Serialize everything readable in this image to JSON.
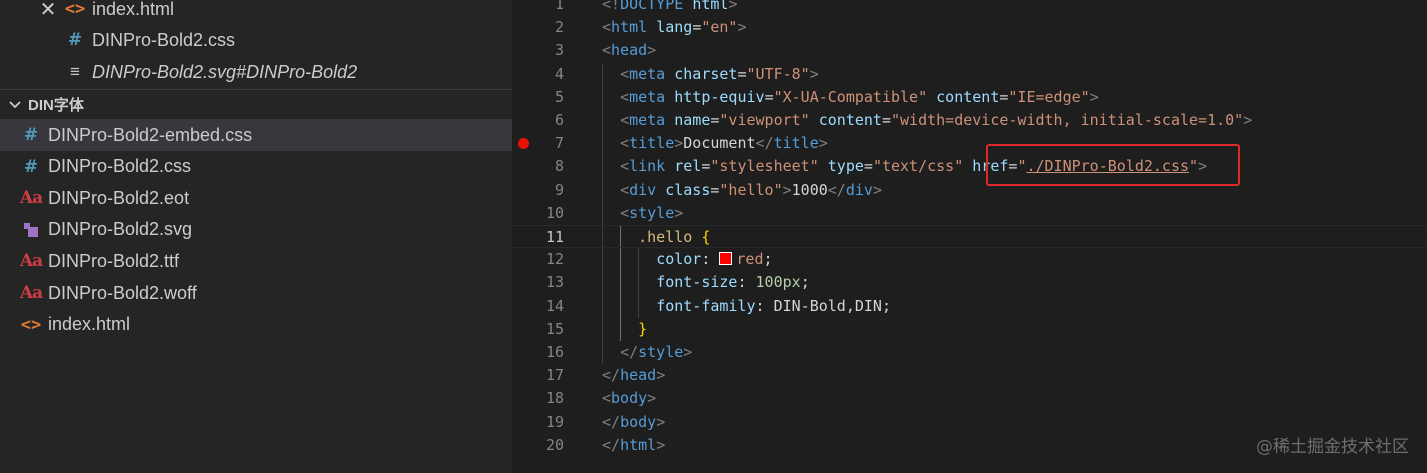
{
  "open_editors": [
    {
      "name": "index.html",
      "icon": "html-file-icon",
      "italic": false,
      "close": true
    },
    {
      "name": "DINPro-Bold2.css",
      "icon": "css-file-icon",
      "italic": false,
      "close": false
    },
    {
      "name": "DINPro-Bold2.svg#DINPro-Bold2",
      "icon": "svg-reference-icon",
      "italic": true,
      "close": false
    }
  ],
  "folder": {
    "name": "DIN字体",
    "expanded": true
  },
  "files": [
    {
      "name": "DINPro-Bold2-embed.css",
      "icon": "css-file-icon",
      "selected": true
    },
    {
      "name": "DINPro-Bold2.css",
      "icon": "css-file-icon",
      "selected": false
    },
    {
      "name": "DINPro-Bold2.eot",
      "icon": "font-file-icon",
      "selected": false
    },
    {
      "name": "DINPro-Bold2.svg",
      "icon": "svg-file-icon",
      "selected": false
    },
    {
      "name": "DINPro-Bold2.ttf",
      "icon": "font-file-icon",
      "selected": false
    },
    {
      "name": "DINPro-Bold2.woff",
      "icon": "font-file-icon",
      "selected": false
    },
    {
      "name": "index.html",
      "icon": "html-file-icon",
      "selected": false
    }
  ],
  "editor": {
    "current_line": 11,
    "breakpoint_line": 7,
    "lines": [
      [
        [
          "t-pun",
          "<!"
        ],
        [
          "t-tag",
          "DOCTYPE"
        ],
        [
          "t-txt",
          " "
        ],
        [
          "t-attr",
          "html"
        ],
        [
          "t-pun",
          ">"
        ]
      ],
      [
        [
          "t-pun",
          "<"
        ],
        [
          "t-tag",
          "html"
        ],
        [
          "t-txt",
          " "
        ],
        [
          "t-attr",
          "lang"
        ],
        [
          "t-txt",
          "="
        ],
        [
          "t-str",
          "\"en\""
        ],
        [
          "t-pun",
          ">"
        ]
      ],
      [
        [
          "t-pun",
          "<"
        ],
        [
          "t-tag",
          "head"
        ],
        [
          "t-pun",
          ">"
        ]
      ],
      [
        [
          "t-txt",
          "  "
        ],
        [
          "t-pun",
          "<"
        ],
        [
          "t-tag",
          "meta"
        ],
        [
          "t-txt",
          " "
        ],
        [
          "t-attr",
          "charset"
        ],
        [
          "t-txt",
          "="
        ],
        [
          "t-str",
          "\"UTF-8\""
        ],
        [
          "t-pun",
          ">"
        ]
      ],
      [
        [
          "t-txt",
          "  "
        ],
        [
          "t-pun",
          "<"
        ],
        [
          "t-tag",
          "meta"
        ],
        [
          "t-txt",
          " "
        ],
        [
          "t-attr",
          "http-equiv"
        ],
        [
          "t-txt",
          "="
        ],
        [
          "t-str",
          "\"X-UA-Compatible\""
        ],
        [
          "t-txt",
          " "
        ],
        [
          "t-attr",
          "content"
        ],
        [
          "t-txt",
          "="
        ],
        [
          "t-str",
          "\"IE=edge\""
        ],
        [
          "t-pun",
          ">"
        ]
      ],
      [
        [
          "t-txt",
          "  "
        ],
        [
          "t-pun",
          "<"
        ],
        [
          "t-tag",
          "meta"
        ],
        [
          "t-txt",
          " "
        ],
        [
          "t-attr",
          "name"
        ],
        [
          "t-txt",
          "="
        ],
        [
          "t-str",
          "\"viewport\""
        ],
        [
          "t-txt",
          " "
        ],
        [
          "t-attr",
          "content"
        ],
        [
          "t-txt",
          "="
        ],
        [
          "t-str",
          "\"width=device-width, initial-scale=1.0\""
        ],
        [
          "t-pun",
          ">"
        ]
      ],
      [
        [
          "t-txt",
          "  "
        ],
        [
          "t-pun",
          "<"
        ],
        [
          "t-tag",
          "title"
        ],
        [
          "t-pun",
          ">"
        ],
        [
          "t-txt",
          "Document"
        ],
        [
          "t-pun",
          "</"
        ],
        [
          "t-tag",
          "title"
        ],
        [
          "t-pun",
          ">"
        ]
      ],
      [
        [
          "t-txt",
          "  "
        ],
        [
          "t-pun",
          "<"
        ],
        [
          "t-tag",
          "link"
        ],
        [
          "t-txt",
          " "
        ],
        [
          "t-attr",
          "rel"
        ],
        [
          "t-txt",
          "="
        ],
        [
          "t-str",
          "\"stylesheet\""
        ],
        [
          "t-txt",
          " "
        ],
        [
          "t-attr",
          "type"
        ],
        [
          "t-txt",
          "="
        ],
        [
          "t-str",
          "\"text/css\""
        ],
        [
          "t-txt",
          " "
        ],
        [
          "t-attr",
          "href"
        ],
        [
          "t-txt",
          "="
        ],
        [
          "t-str",
          "\""
        ],
        [
          "t-str link-ul",
          "./DINPro-Bold2.css"
        ],
        [
          "t-str",
          "\""
        ],
        [
          "t-pun",
          ">"
        ]
      ],
      [
        [
          "t-txt",
          "  "
        ],
        [
          "t-pun",
          "<"
        ],
        [
          "t-tag",
          "div"
        ],
        [
          "t-txt",
          " "
        ],
        [
          "t-attr",
          "class"
        ],
        [
          "t-txt",
          "="
        ],
        [
          "t-str",
          "\"hello\""
        ],
        [
          "t-pun",
          ">"
        ],
        [
          "t-txt",
          "1000"
        ],
        [
          "t-pun",
          "</"
        ],
        [
          "t-tag",
          "div"
        ],
        [
          "t-pun",
          ">"
        ]
      ],
      [
        [
          "t-txt",
          "  "
        ],
        [
          "t-pun",
          "<"
        ],
        [
          "t-tag",
          "style"
        ],
        [
          "t-pun",
          ">"
        ]
      ],
      [
        [
          "t-txt",
          "    "
        ],
        [
          "t-sel",
          ".hello"
        ],
        [
          "t-txt",
          " "
        ],
        [
          "t-brace",
          "{"
        ]
      ],
      [
        [
          "t-txt",
          "      "
        ],
        [
          "t-prop",
          "color"
        ],
        [
          "t-plain",
          ": "
        ],
        [
          "swatch",
          ""
        ],
        [
          "t-val",
          "red"
        ],
        [
          "t-plain",
          ";"
        ]
      ],
      [
        [
          "t-txt",
          "      "
        ],
        [
          "t-prop",
          "font-size"
        ],
        [
          "t-plain",
          ": "
        ],
        [
          "t-num",
          "100px"
        ],
        [
          "t-plain",
          ";"
        ]
      ],
      [
        [
          "t-txt",
          "      "
        ],
        [
          "t-prop",
          "font-family"
        ],
        [
          "t-plain",
          ": DIN-Bold,DIN;"
        ]
      ],
      [
        [
          "t-txt",
          "    "
        ],
        [
          "t-brace",
          "}"
        ]
      ],
      [
        [
          "t-txt",
          "  "
        ],
        [
          "t-pun",
          "</"
        ],
        [
          "t-tag",
          "style"
        ],
        [
          "t-pun",
          ">"
        ]
      ],
      [
        [
          "t-pun",
          "</"
        ],
        [
          "t-tag",
          "head"
        ],
        [
          "t-pun",
          ">"
        ]
      ],
      [
        [
          "t-pun",
          "<"
        ],
        [
          "t-tag",
          "body"
        ],
        [
          "t-pun",
          ">"
        ]
      ],
      [
        [
          "t-pun",
          "</"
        ],
        [
          "t-tag",
          "body"
        ],
        [
          "t-pun",
          ">"
        ]
      ],
      [
        [
          "t-pun",
          "</"
        ],
        [
          "t-tag",
          "html"
        ],
        [
          "t-pun",
          ">"
        ]
      ]
    ]
  },
  "highlight_color": "#e02828",
  "watermark": "@稀土掘金技术社区"
}
